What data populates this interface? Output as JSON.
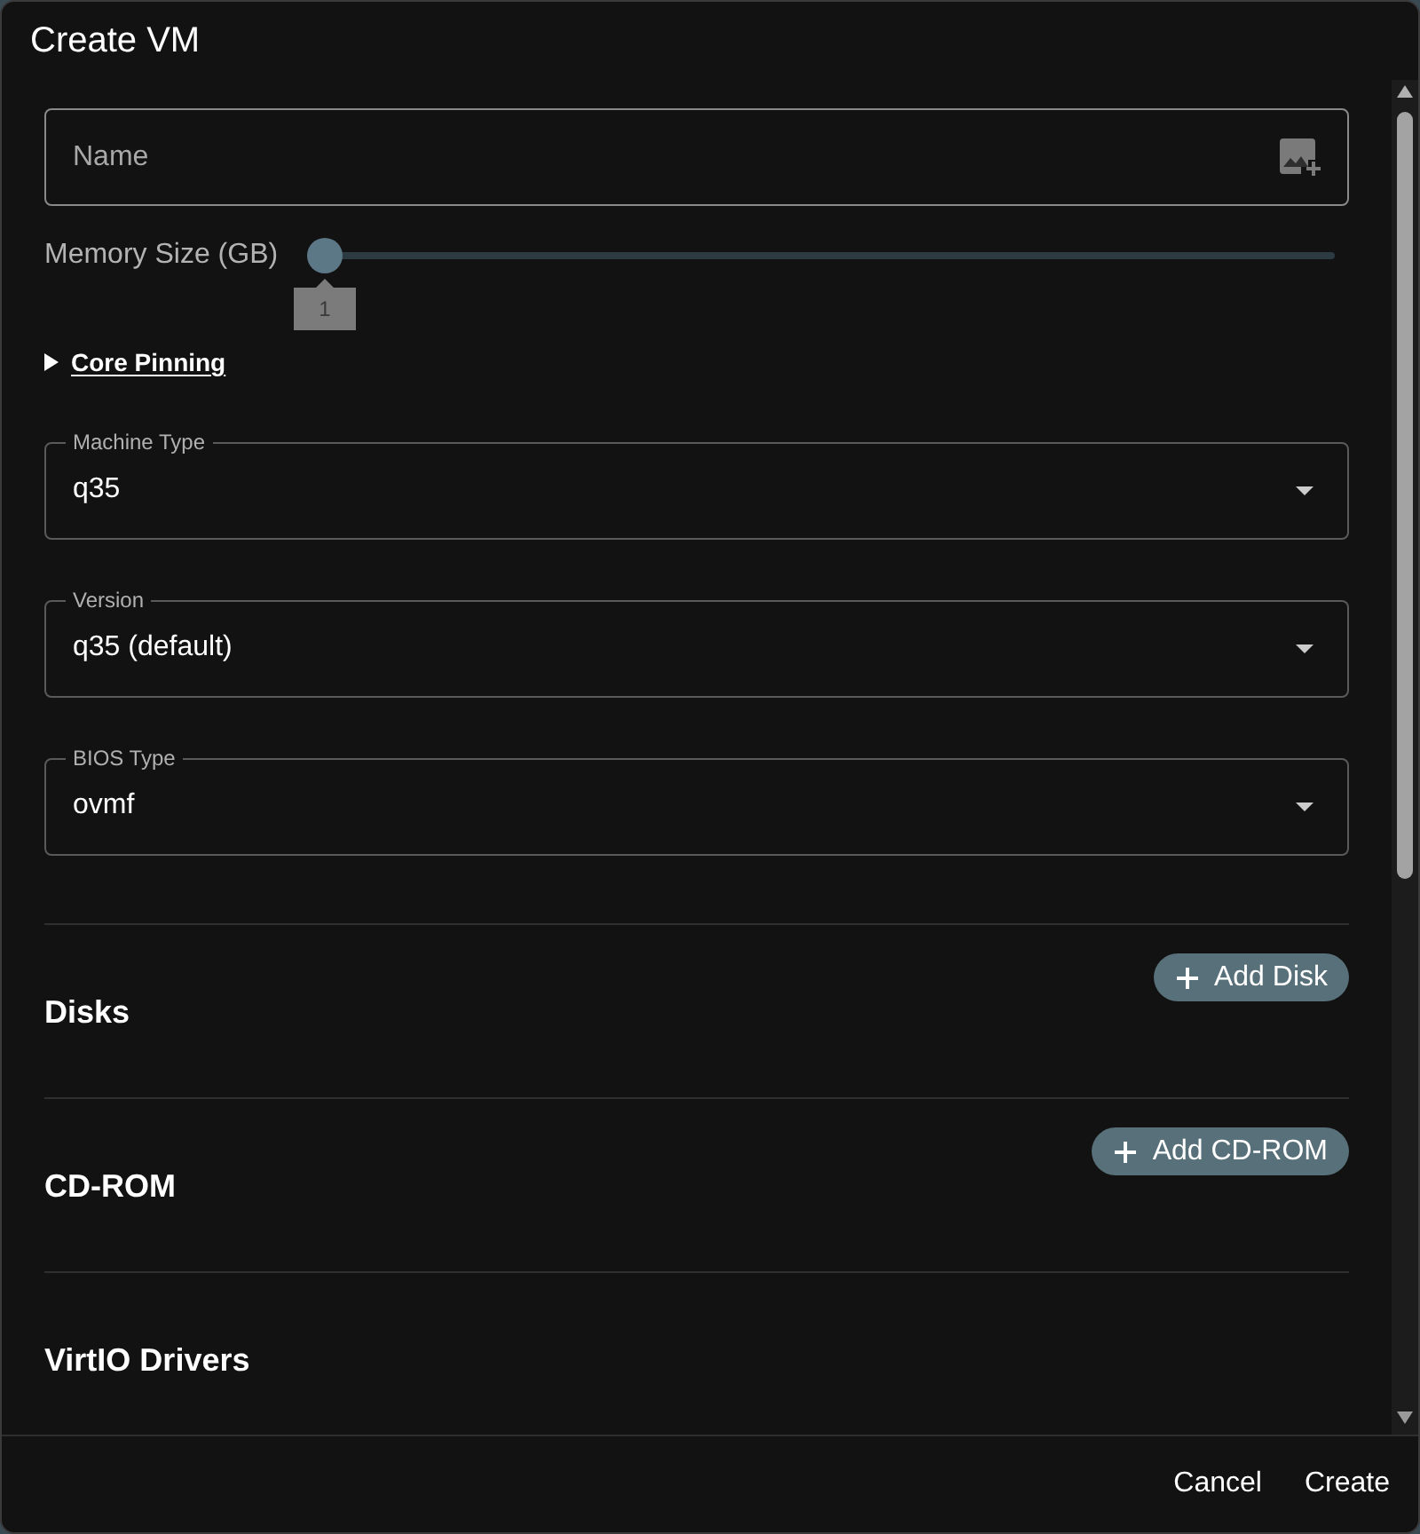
{
  "dialog": {
    "title": "Create VM"
  },
  "name_field": {
    "placeholder": "Name"
  },
  "memory_slider": {
    "label": "Memory Size (GB)",
    "level": 0,
    "value_label": "1"
  },
  "core_pinning": {
    "label": "Core Pinning",
    "expanded": false
  },
  "selects": [
    {
      "label": "Machine Type",
      "value": "q35"
    },
    {
      "label": "Version",
      "value": "q35 (default)"
    },
    {
      "label": "BIOS Type",
      "value": "ovmf"
    }
  ],
  "sections": [
    {
      "title": "Disks",
      "button": "Add Disk"
    },
    {
      "title": "CD-ROM",
      "button": "Add CD-ROM"
    },
    {
      "title": "VirtIO Drivers"
    }
  ],
  "footer_buttons": [
    {
      "label": "Cancel"
    },
    {
      "label": "Create"
    }
  ]
}
